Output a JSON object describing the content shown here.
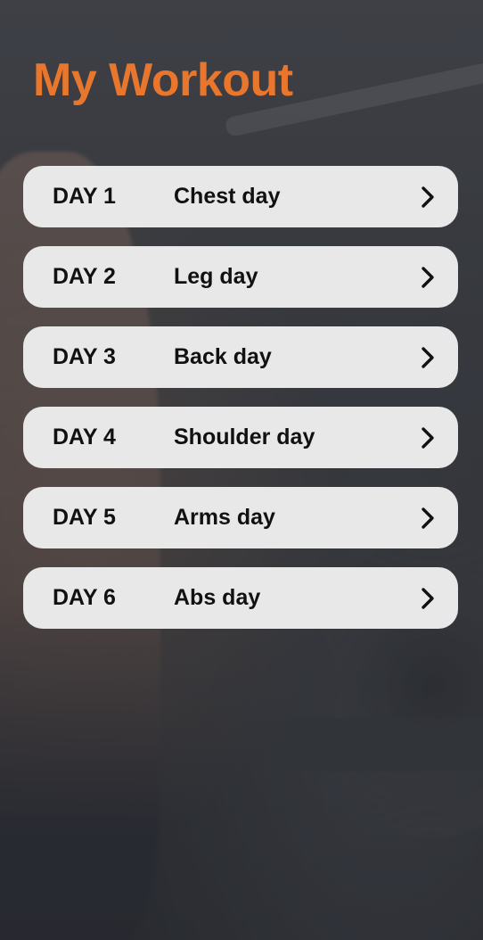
{
  "page": {
    "title": "My Workout"
  },
  "colors": {
    "accent": "#e8762d",
    "card_background": "#e8e8e8",
    "card_text": "#111111"
  },
  "days": [
    {
      "number": "DAY 1",
      "name": "Chest day",
      "icon": "chevron-right-icon"
    },
    {
      "number": "DAY 2",
      "name": "Leg day",
      "icon": "chevron-right-icon"
    },
    {
      "number": "DAY 3",
      "name": "Back day",
      "icon": "chevron-right-icon"
    },
    {
      "number": "DAY 4",
      "name": "Shoulder day",
      "icon": "chevron-right-icon"
    },
    {
      "number": "DAY 5",
      "name": "Arms day",
      "icon": "chevron-right-icon"
    },
    {
      "number": "DAY 6",
      "name": "Abs day",
      "icon": "chevron-right-icon"
    }
  ]
}
